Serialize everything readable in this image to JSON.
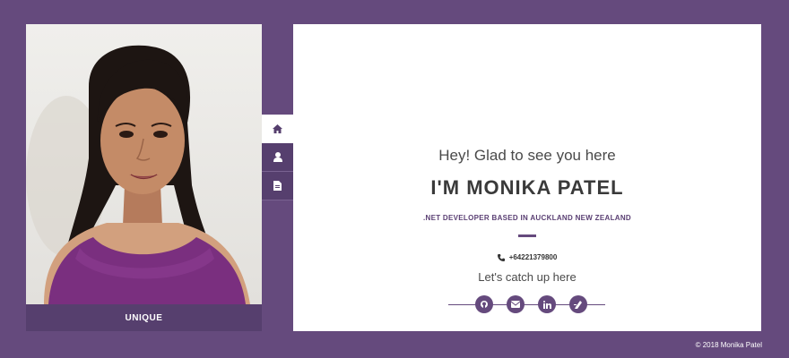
{
  "profile": {
    "caption": "UNIQUE"
  },
  "nav": {
    "items": [
      {
        "icon": "home-icon"
      },
      {
        "icon": "user-icon"
      },
      {
        "icon": "document-icon"
      }
    ]
  },
  "hero": {
    "greeting": "Hey! Glad to see you here",
    "name": "I'M MONIKA PATEL",
    "tagline": ".NET DEVELOPER BASED IN AUCKLAND NEW ZEALAND",
    "phone": "+64221379800",
    "catchup": "Let's catch up here"
  },
  "social": [
    {
      "icon": "github-icon"
    },
    {
      "icon": "email-icon"
    },
    {
      "icon": "linkedin-icon"
    },
    {
      "icon": "blog-icon"
    }
  ],
  "footer": {
    "copyright": "© 2018 Monika Patel"
  },
  "colors": {
    "background": "#654a7d",
    "accent_dark": "#563f6e",
    "card": "#ffffff"
  }
}
